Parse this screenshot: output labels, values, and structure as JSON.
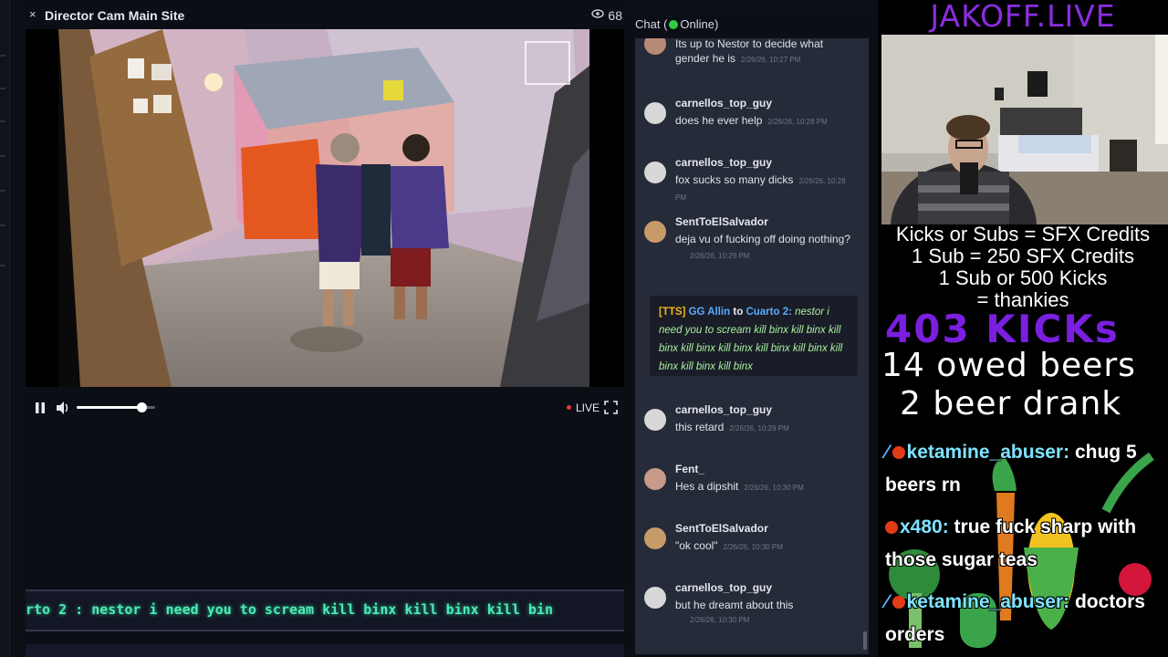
{
  "player": {
    "close_glyph": "×",
    "title": "Director Cam Main Site",
    "viewers": "68",
    "live_label": "LIVE",
    "volume_level": 0.82,
    "ticker": "rto 2 : nestor i need you to scream kill binx kill binx kill bin"
  },
  "chat": {
    "header_prefix": "Chat (",
    "header_status": "Online)",
    "messages": [
      {
        "user": "",
        "text": "Its up to Nestor to decide what",
        "text2": "gender he is",
        "time": "2/26/26, 10:27 PM"
      },
      {
        "user": "carnellos_top_guy",
        "text": "does he ever help",
        "time": "2/26/26, 10:28 PM"
      },
      {
        "user": "carnellos_top_guy",
        "text": "fox sucks so many dicks",
        "time": "2/26/26, 10:28 PM"
      },
      {
        "user": "SentToElSalvador",
        "text": "deja vu of fucking off doing nothing?",
        "time": "2/26/26, 10:29 PM"
      },
      {
        "user": "carnellos_top_guy",
        "text": "this retard",
        "time": "2/26/26, 10:29 PM"
      },
      {
        "user": "Fent_",
        "text": "Hes a dipshit",
        "time": "2/26/26, 10:30 PM"
      },
      {
        "user": "SentToElSalvador",
        "text": "\"ok cool\"",
        "time": "2/26/26, 10:30 PM"
      },
      {
        "user": "carnellos_top_guy",
        "text": "but he dreamt about this",
        "time": "2/26/26, 10:30 PM"
      }
    ],
    "tts": {
      "tag": "[TTS]",
      "from": "GG Allin",
      "to_word": "to",
      "target": "Cuarto 2:",
      "text": "nestor i need you to scream kill binx kill binx kill binx kill binx kill binx kill binx kill binx kill binx kill binx kill binx"
    }
  },
  "overlay": {
    "brand": "JAKOFF.LIVE",
    "line1": "Kicks or Subs = SFX Credits",
    "line2": "1 Sub = 250 SFX Credits",
    "line3": "1 Sub or 500 Kicks",
    "line4": "= thankies",
    "kicks": "403 KICKs",
    "owed": "14 owed beers",
    "drank": "2 beer drank",
    "events": [
      {
        "user": "ketamine_abuser:",
        "text": " chug 5",
        "text2": "beers rn"
      },
      {
        "user": "x480:",
        "text": " true fuck sharp with",
        "text2": "those sugar teas"
      },
      {
        "user": "ketamine_abuser:",
        "text": " doctors",
        "text2": "orders"
      }
    ]
  },
  "colors": {
    "accent_live": "#e53935",
    "online": "#2ecc40",
    "brand": "#8a2de0",
    "ticker": "#4fe9b6"
  }
}
